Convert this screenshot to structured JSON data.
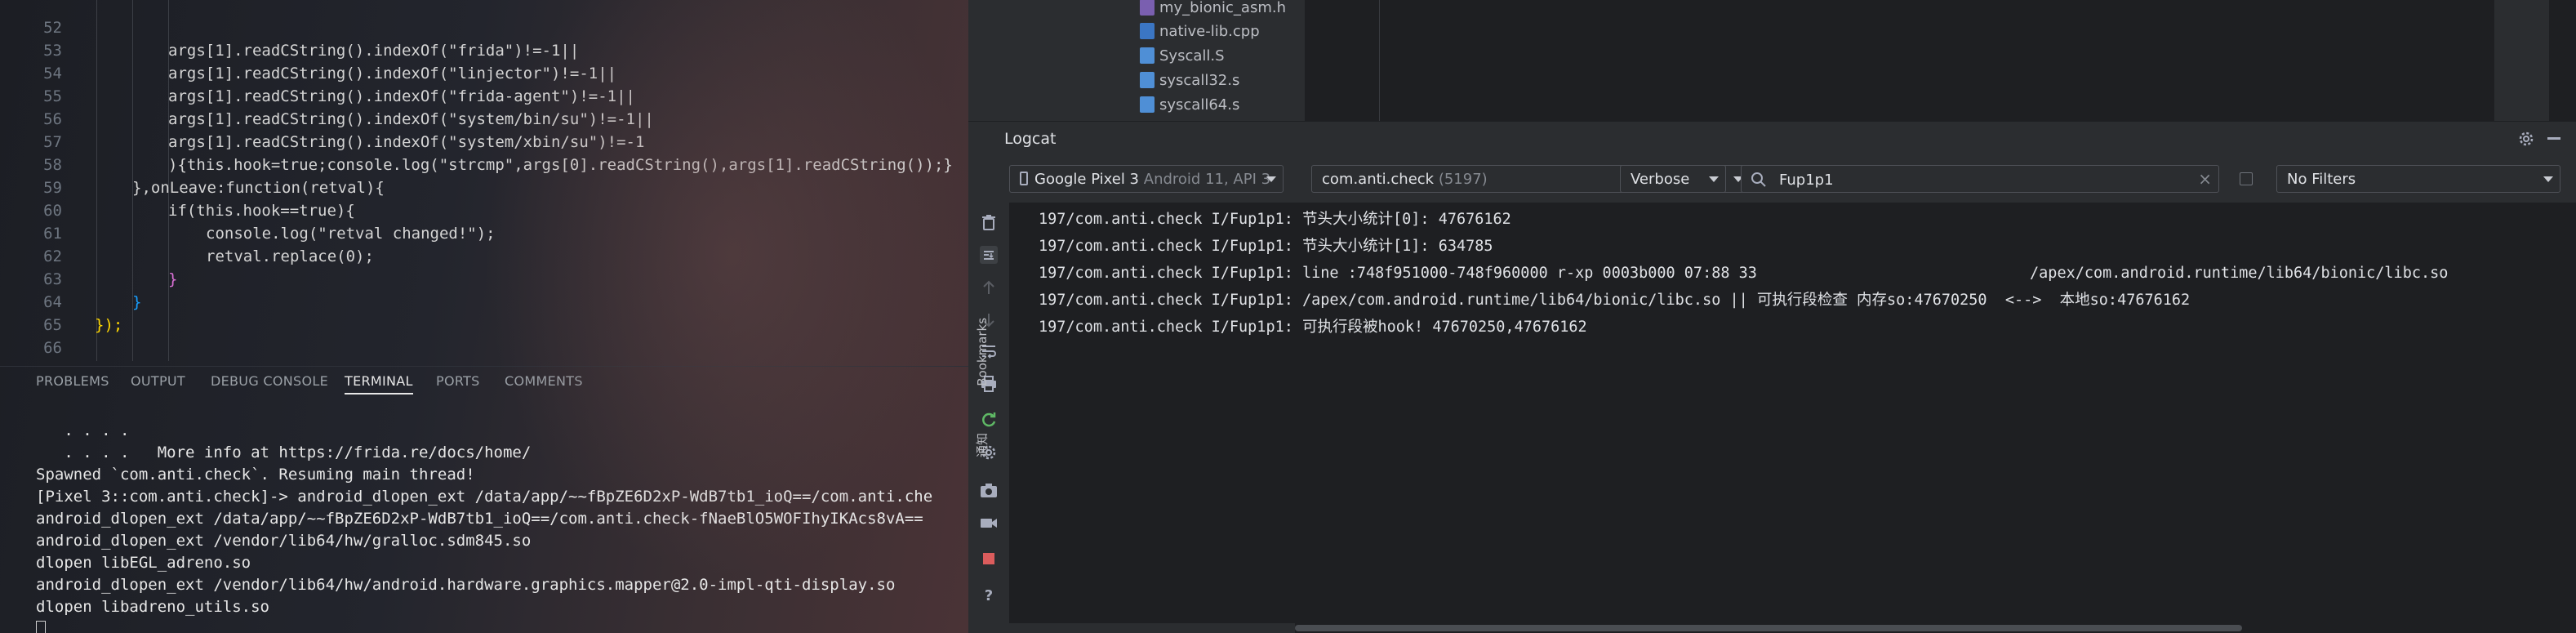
{
  "editor": {
    "lines": [
      {
        "n": "52",
        "code": "args[1].readCString().indexOf(\"frida\")!=-1||"
      },
      {
        "n": "53",
        "code": "args[1].readCString().indexOf(\"linjector\")!=-1||"
      },
      {
        "n": "54",
        "code": "args[1].readCString().indexOf(\"frida-agent\")!=-1||"
      },
      {
        "n": "55",
        "code": "args[1].readCString().indexOf(\"system/bin/su\")!=-1||"
      },
      {
        "n": "56",
        "code": "args[1].readCString().indexOf(\"system/xbin/su\")!=-1"
      },
      {
        "n": "57",
        "code": "){this.hook=true;console.log(\"strcmp\",args[0].readCString(),args[1].readCString());}"
      },
      {
        "n": "58",
        "code": "},onLeave:function(retval){"
      },
      {
        "n": "59",
        "code": "if(this.hook==true){"
      },
      {
        "n": "60",
        "code": "console.log(\"retval changed!\");"
      },
      {
        "n": "61",
        "code": "retval.replace(0);"
      },
      {
        "n": "62",
        "code": "}"
      },
      {
        "n": "63",
        "code": "}"
      },
      {
        "n": "64",
        "code": "});"
      },
      {
        "n": "65",
        "code": ""
      },
      {
        "n": "66",
        "code": ""
      }
    ]
  },
  "panel_tabs": {
    "problems": "PROBLEMS",
    "output": "OUTPUT",
    "debug_console": "DEBUG CONSOLE",
    "terminal": "TERMINAL",
    "ports": "PORTS",
    "comments": "COMMENTS"
  },
  "terminal": {
    "lines": [
      "   . . . .",
      "   . . . .   More info at https://frida.re/docs/home/",
      "Spawned `com.anti.check`. Resuming main thread!",
      "[Pixel 3::com.anti.check]-> android_dlopen_ext /data/app/~~fBpZE6D2xP-WdB7tb1_ioQ==/com.anti.che",
      "android_dlopen_ext /data/app/~~fBpZE6D2xP-WdB7tb1_ioQ==/com.anti.check-fNaeBlO5WOFIhyIKAcs8vA==",
      "android_dlopen_ext /vendor/lib64/hw/gralloc.sdm845.so",
      "dlopen libEGL_adreno.so",
      "android_dlopen_ext /vendor/lib64/hw/android.hardware.graphics.mapper@2.0-impl-qti-display.so",
      "dlopen libadreno_utils.so"
    ]
  },
  "project_tree": {
    "items": [
      {
        "label": "my_bionic_asm.h",
        "icon": "header-file-icon"
      },
      {
        "label": "native-lib.cpp",
        "icon": "cpp-file-icon"
      },
      {
        "label": "Syscall.S",
        "icon": "asm-file-icon"
      },
      {
        "label": "syscall32.s",
        "icon": "asm-file-icon"
      },
      {
        "label": "syscall64.s",
        "icon": "asm-file-icon"
      }
    ]
  },
  "logcat": {
    "title": "Logcat",
    "device": {
      "name": "Google Pixel 3",
      "detail": "Android 11, API 3"
    },
    "process": {
      "name": "com.anti.check",
      "pid": "(5197)"
    },
    "level": "Verbose",
    "filter": "Fup1p1",
    "filters_option": "No Filters",
    "lines": [
      "197/com.anti.check I/Fup1p1: 节头大小统计[0]: 47676162",
      "197/com.anti.check I/Fup1p1: 节头大小统计[1]: 634785",
      "197/com.anti.check I/Fup1p1: line :748f951000-748f960000 r-xp 0003b000 07:88 33                              /apex/com.android.runtime/lib64/bionic/libc.so",
      "197/com.anti.check I/Fup1p1: /apex/com.android.runtime/lib64/bionic/libc.so || 可执行段检查 内存so:47670250  <-->  本地so:47676162",
      "197/com.anti.check I/Fup1p1: 可执行段被hook! 47670250,47676162"
    ]
  },
  "sidebar": {
    "bookmarks_label": "Bookmarks",
    "other_label": "通知"
  },
  "colors": {
    "accent_red": "#db5c5c",
    "accent_green": "#5fb865",
    "logcat_bg": "#1e1f22",
    "studio_bg": "#2b2d30"
  }
}
